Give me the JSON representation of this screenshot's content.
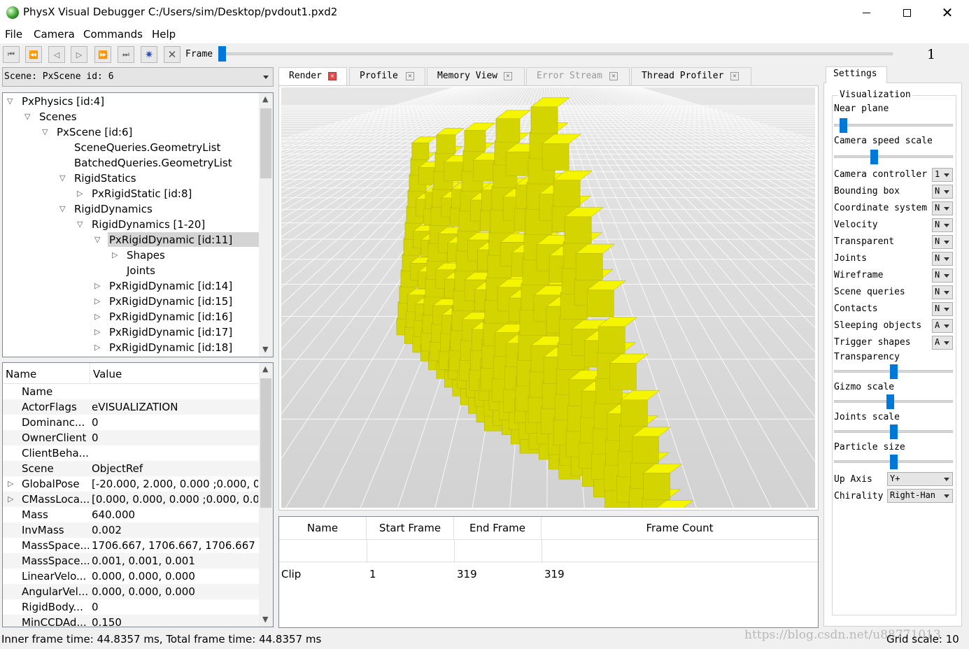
{
  "window": {
    "title": "PhysX Visual Debugger C:/Users/sim/Desktop/pvdout1.pxd2"
  },
  "menu": [
    "File",
    "Camera",
    "Commands",
    "Help"
  ],
  "toolbar": {
    "frame_label": "Frame",
    "frame_value": "1",
    "frame_progress": 0.0
  },
  "scene_selector": {
    "value": "Scene: PxScene id: 6"
  },
  "tree": [
    {
      "label": "PxPhysics [id:4]",
      "depth": 0,
      "arrow": "expanded"
    },
    {
      "label": "Scenes",
      "depth": 1,
      "arrow": "expanded"
    },
    {
      "label": "PxScene [id:6]",
      "depth": 2,
      "arrow": "expanded"
    },
    {
      "label": "SceneQueries.GeometryList",
      "depth": 3,
      "arrow": "none"
    },
    {
      "label": "BatchedQueries.GeometryList",
      "depth": 3,
      "arrow": "none"
    },
    {
      "label": "RigidStatics",
      "depth": 3,
      "arrow": "expanded"
    },
    {
      "label": "PxRigidStatic [id:8]",
      "depth": 4,
      "arrow": "collapsed"
    },
    {
      "label": "RigidDynamics",
      "depth": 3,
      "arrow": "expanded"
    },
    {
      "label": "RigidDynamics [1-20]",
      "depth": 4,
      "arrow": "expanded"
    },
    {
      "label": "PxRigidDynamic [id:11]",
      "depth": 5,
      "arrow": "expanded",
      "selected": true
    },
    {
      "label": "Shapes",
      "depth": 6,
      "arrow": "collapsed"
    },
    {
      "label": "Joints",
      "depth": 6,
      "arrow": "none"
    },
    {
      "label": "PxRigidDynamic [id:14]",
      "depth": 5,
      "arrow": "collapsed"
    },
    {
      "label": "PxRigidDynamic [id:15]",
      "depth": 5,
      "arrow": "collapsed"
    },
    {
      "label": "PxRigidDynamic [id:16]",
      "depth": 5,
      "arrow": "collapsed"
    },
    {
      "label": "PxRigidDynamic [id:17]",
      "depth": 5,
      "arrow": "collapsed"
    },
    {
      "label": "PxRigidDynamic [id:18]",
      "depth": 5,
      "arrow": "collapsed"
    }
  ],
  "properties": {
    "columns": [
      "Name",
      "Value"
    ],
    "rows": [
      {
        "name": "Name",
        "value": "",
        "expandable": false
      },
      {
        "name": "ActorFlags",
        "value": "eVISUALIZATION",
        "expandable": false
      },
      {
        "name": "Dominanc...",
        "value": "0",
        "expandable": false
      },
      {
        "name": "OwnerClient",
        "value": "0",
        "expandable": false
      },
      {
        "name": "ClientBeha...",
        "value": "",
        "expandable": false
      },
      {
        "name": "Scene",
        "value": "ObjectRef",
        "expandable": false
      },
      {
        "name": "GlobalPose",
        "value": "[-20.000, 2.000, 0.000 ;0.000, 0...",
        "expandable": true
      },
      {
        "name": "CMassLoca...",
        "value": "[0.000, 0.000, 0.000 ;0.000, 0.0...",
        "expandable": true
      },
      {
        "name": "Mass",
        "value": "640.000",
        "expandable": false
      },
      {
        "name": "InvMass",
        "value": "0.002",
        "expandable": false
      },
      {
        "name": "MassSpace...",
        "value": "1706.667, 1706.667, 1706.667",
        "expandable": false
      },
      {
        "name": "MassSpace...",
        "value": "0.001, 0.001, 0.001",
        "expandable": false
      },
      {
        "name": "LinearVelo...",
        "value": "0.000, 0.000, 0.000",
        "expandable": false
      },
      {
        "name": "AngularVel...",
        "value": "0.000, 0.000, 0.000",
        "expandable": false
      },
      {
        "name": "RigidBody...",
        "value": "0",
        "expandable": false
      },
      {
        "name": "MinCCDAd...",
        "value": "0.150",
        "expandable": false
      }
    ]
  },
  "tabs": [
    {
      "label": "Render",
      "active": true,
      "disabled": false
    },
    {
      "label": "Profile",
      "active": false,
      "disabled": false
    },
    {
      "label": "Memory View",
      "active": false,
      "disabled": false
    },
    {
      "label": "Error Stream",
      "active": false,
      "disabled": true
    },
    {
      "label": "Thread Profiler",
      "active": false,
      "disabled": false
    }
  ],
  "clips": {
    "columns": [
      "Name",
      "Start Frame",
      "End Frame",
      "Frame Count"
    ],
    "rows": [
      [
        "Clip",
        "1",
        "319",
        "319"
      ]
    ]
  },
  "settings": {
    "tab_label": "Settings",
    "group_label": "Visualization",
    "near_plane": {
      "label": "Near plane",
      "value": 0.05
    },
    "camera_speed": {
      "label": "Camera speed scale",
      "value": 0.33
    },
    "dropdowns": [
      {
        "label": "Camera controller",
        "value": "1"
      },
      {
        "label": "Bounding box",
        "value": "N"
      },
      {
        "label": "Coordinate system",
        "value": "N"
      },
      {
        "label": "Velocity",
        "value": "N"
      },
      {
        "label": "Transparent",
        "value": "N"
      },
      {
        "label": "Joints",
        "value": "N"
      },
      {
        "label": "Wireframe",
        "value": "N"
      },
      {
        "label": "Scene queries",
        "value": "N"
      },
      {
        "label": "Contacts",
        "value": "N"
      },
      {
        "label": "Sleeping objects",
        "value": "A"
      },
      {
        "label": "Trigger shapes",
        "value": "A"
      }
    ],
    "sliders2": [
      {
        "label": "Transparency",
        "value": 0.5
      },
      {
        "label": "Gizmo scale",
        "value": 0.47
      },
      {
        "label": "Joints scale",
        "value": 0.5
      },
      {
        "label": "Particle size",
        "value": 0.5
      }
    ],
    "up_axis": {
      "label": "Up Axis",
      "value": "Y+"
    },
    "chirality": {
      "label": "Chirality",
      "value": "Right-Han"
    }
  },
  "status": {
    "frame_time": "Inner frame time: 44.8357 ms, Total frame time: 44.8357 ms",
    "grid_scale": "Grid scale: 10",
    "watermark": "https://blog.csdn.net/u88771013"
  },
  "colors": {
    "accent": "#0078d7",
    "box_top": "#f5f500",
    "box_front": "#d4d400",
    "box_side": "#4a4a00",
    "tab_close_active": "#e04c4c"
  }
}
